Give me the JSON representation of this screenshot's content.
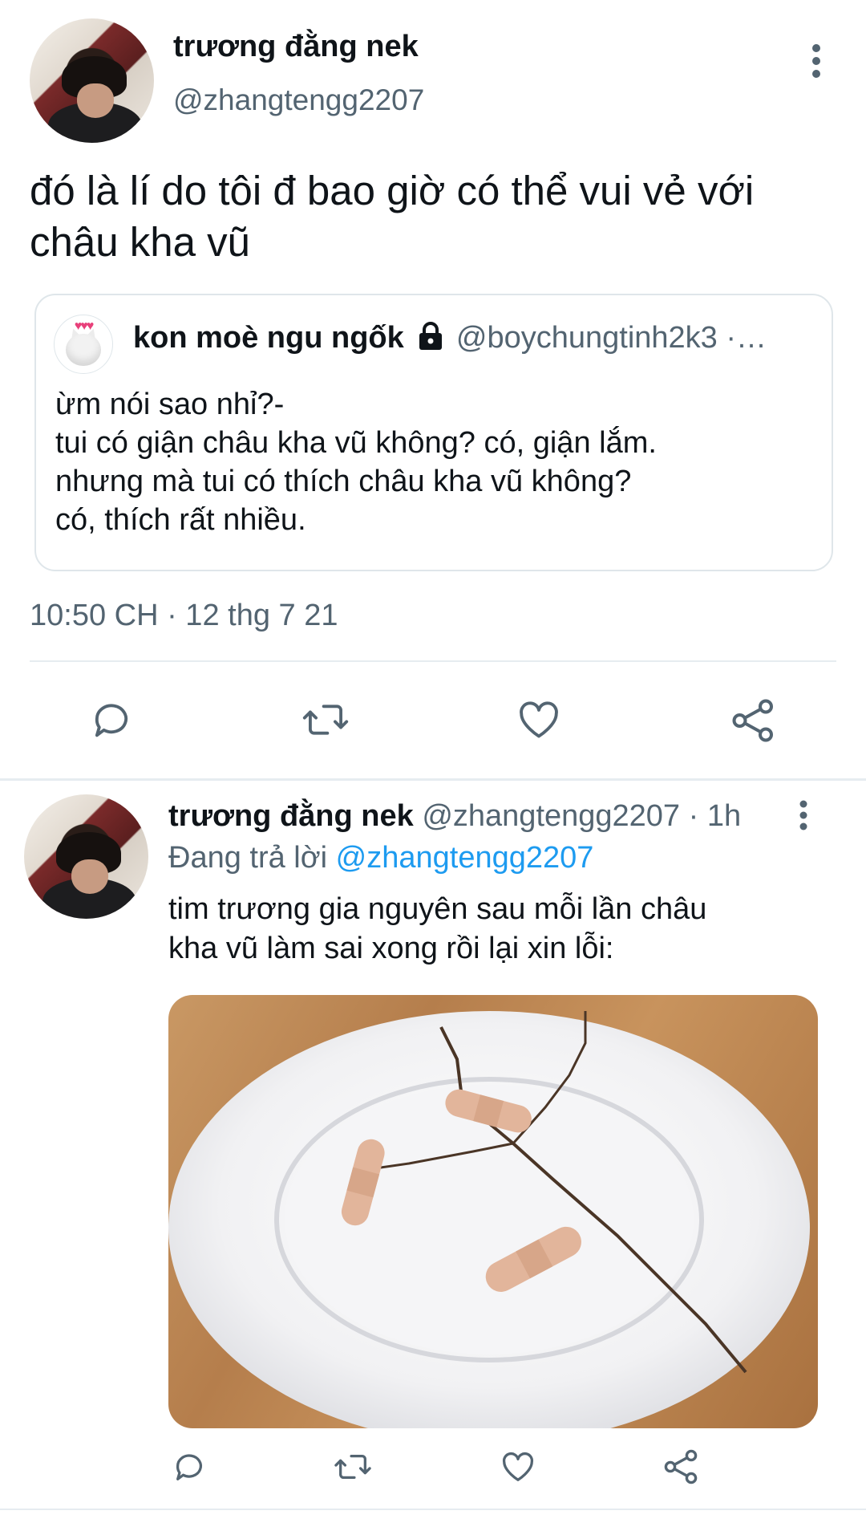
{
  "main_tweet": {
    "display_name": "trương đằng nek",
    "handle": "@zhangtengg2207",
    "text_line1": "đó là lí do tôi đ bao giờ có thể vui vẻ với",
    "text_line2": "châu kha vũ",
    "timestamp": "10:50 CH · 12 thg 7 21",
    "more_icon": "vertical-ellipsis-icon"
  },
  "quoted_tweet": {
    "display_name": "kon moè ngu ngốk",
    "lock_icon": "lock-icon",
    "handle": "@boychungtinh2k3 ·…",
    "lines": [
      "ừm nói sao nhỉ?-",
      "tui có giận châu kha vũ không? có, giận lắm.",
      "nhưng mà tui có thích châu kha vũ không?",
      "có, thích rất nhiều."
    ]
  },
  "actions": {
    "reply_icon": "reply-icon",
    "retweet_icon": "retweet-icon",
    "like_icon": "heart-icon",
    "share_icon": "share-icon"
  },
  "reply_tweet": {
    "display_name": "trương đằng nek",
    "handle_time": "@zhangtengg2207 · 1h",
    "replying_prefix": "Đang trả lời",
    "replying_to": "@zhangtengg2207",
    "text_line1": "tim trương gia nguyên sau mỗi lần châu",
    "text_line2": "kha vũ làm sai xong rồi lại xin lỗi:",
    "image": "broken-plate-with-bandages"
  },
  "colors": {
    "link": "#1d9bf0",
    "muted": "#536471",
    "text": "#0f1419",
    "border": "#dfe6ea"
  }
}
